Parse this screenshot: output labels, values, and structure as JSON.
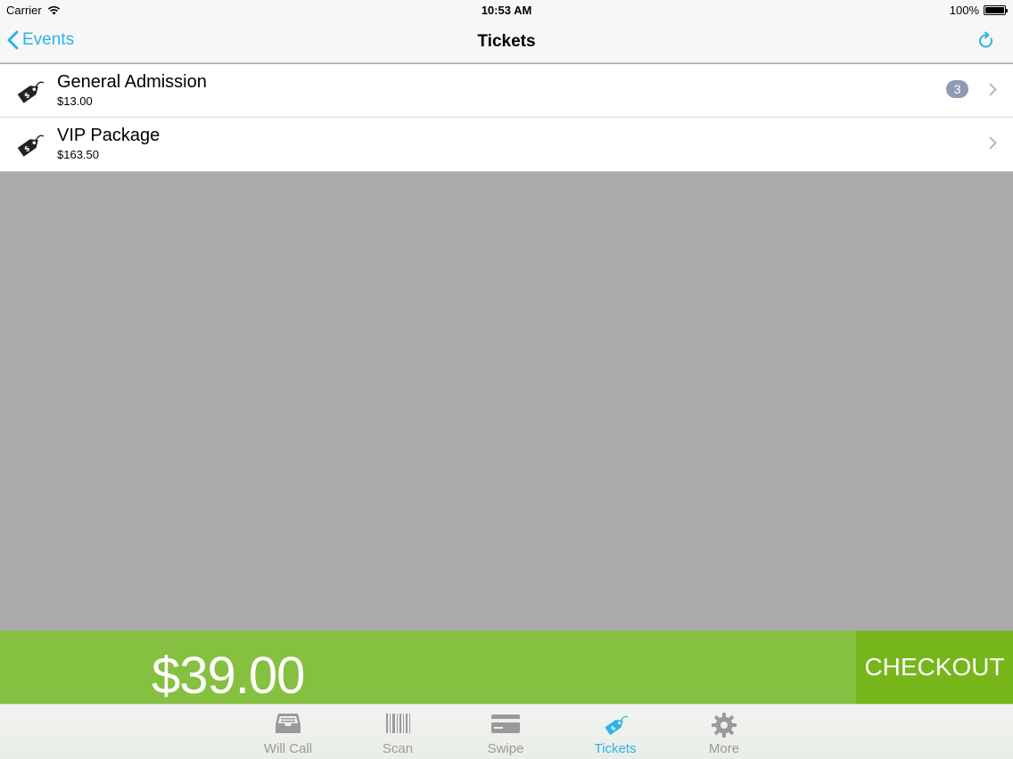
{
  "status_bar": {
    "carrier": "Carrier",
    "time": "10:53 AM",
    "battery": "100%"
  },
  "nav": {
    "back_label": "Events",
    "title": "Tickets"
  },
  "tickets": [
    {
      "name": "General Admission",
      "price": "$13.00",
      "badge": "3"
    },
    {
      "name": "VIP Package",
      "price": "$163.50",
      "badge": ""
    }
  ],
  "checkout": {
    "total": "$39.00",
    "button_label": "CHECKOUT"
  },
  "tabs": [
    {
      "label": "Will Call",
      "icon": "inbox-tray-icon"
    },
    {
      "label": "Scan",
      "icon": "barcode-icon"
    },
    {
      "label": "Swipe",
      "icon": "credit-card-icon"
    },
    {
      "label": "Tickets",
      "icon": "ticket-tag-icon",
      "active": true
    },
    {
      "label": "More",
      "icon": "gear-icon"
    }
  ],
  "colors": {
    "accent": "#2fb3e6",
    "checkout_green": "#86c040",
    "checkout_button_green": "#77b61b",
    "badge": "#8e9ab4",
    "background": "#acaaad"
  }
}
